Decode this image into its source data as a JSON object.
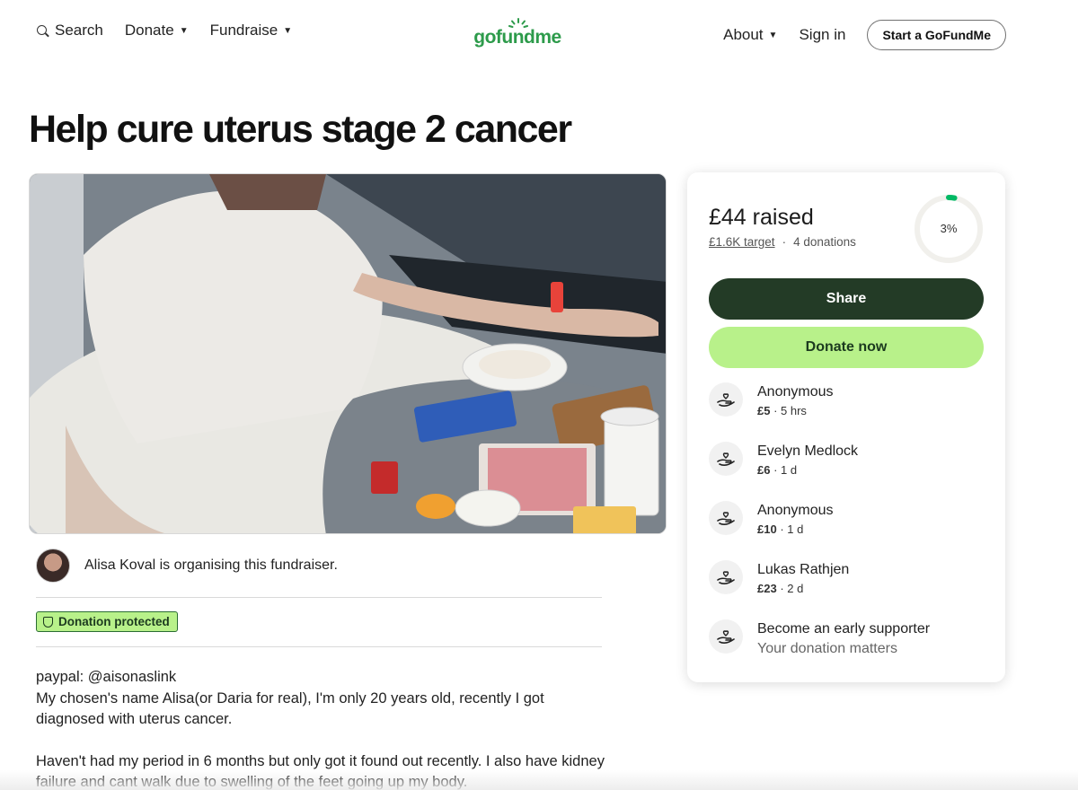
{
  "header": {
    "search_label": "Search",
    "donate_label": "Donate",
    "fundraise_label": "Fundraise",
    "logo_text": "gofundme",
    "about_label": "About",
    "signin_label": "Sign in",
    "start_label": "Start a GoFundMe"
  },
  "page": {
    "title": "Help cure uterus stage 2 cancer"
  },
  "organizer": {
    "text": "Alisa Koval is organising this fundraiser.",
    "badge": "Donation protected"
  },
  "story": {
    "line1": "paypal: @aisonaslink",
    "line2": "My chosen's name Alisa(or Daria for real), I'm only 20 years old, recently I got diagnosed with uterus cancer.",
    "line3": "Haven't had my period in 6 months but only got it found out recently. I also have kidney failure and cant walk due to swelling of the feet going up my body."
  },
  "card": {
    "raised": "£44 raised",
    "target": "£1.6K target",
    "separator": "·",
    "donations": "4 donations",
    "percent_label": "3%",
    "progress_fraction": 0.03,
    "share_label": "Share",
    "donate_label": "Donate now",
    "donors": [
      {
        "name": "Anonymous",
        "amount": "£5",
        "time": " · 5 hrs"
      },
      {
        "name": "Evelyn Medlock",
        "amount": "£6",
        "time": " · 1 d"
      },
      {
        "name": "Anonymous",
        "amount": "£10",
        "time": " · 1 d"
      },
      {
        "name": "Lukas Rathjen",
        "amount": "£23",
        "time": " · 2 d"
      }
    ],
    "early_title": "Become an early supporter",
    "early_sub": "Your donation matters"
  },
  "colors": {
    "brand_green": "#2d9b4b",
    "dark_green": "#233b26",
    "light_green": "#b8f18a",
    "progress_green": "#00b964"
  }
}
